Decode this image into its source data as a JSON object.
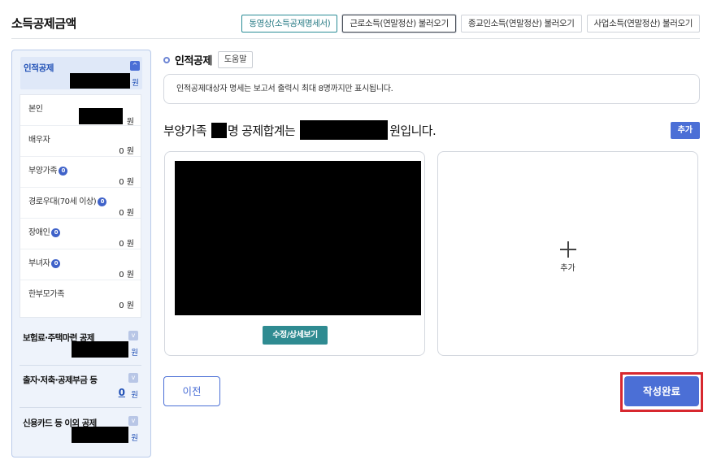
{
  "page_title": "소득공제금액",
  "top_tabs": [
    "동영상(소득공제명세서)",
    "근로소득(연말정산) 불러오기",
    "종교인소득(연말정산) 불러오기",
    "사업소득(연말정산) 불러오기"
  ],
  "sidebar": {
    "head": {
      "label": "인적공제",
      "toggle": "^",
      "unit": "원"
    },
    "sub_items": [
      {
        "label": "본인",
        "value": "원"
      },
      {
        "label": "배우자",
        "value": "0 원"
      },
      {
        "label": "부양가족",
        "badge": "0",
        "value": "0 원"
      },
      {
        "label": "경로우대(70세 이상)",
        "badge": "0",
        "value": "0 원"
      },
      {
        "label": "장애인",
        "badge": "0",
        "value": "0 원"
      },
      {
        "label": "부녀자",
        "badge": "0",
        "value": "0 원"
      },
      {
        "label": "한부모가족",
        "value": "0 원"
      }
    ],
    "groups": [
      {
        "label": "보험료·주택마련 공제",
        "unit": "원"
      },
      {
        "label": "출자·저축·공제부금 등",
        "zero": "0",
        "unit": "원"
      },
      {
        "label": "신용카드 등 이외 공제",
        "unit": "원"
      }
    ],
    "toggle_down": "v"
  },
  "main": {
    "section_title": "인적공제",
    "help_label": "도움말",
    "notice": "인적공제대상자 명세는 보고서 출력시 최대 8명까지만 표시됩니다.",
    "summary": {
      "prefix": "부양가족",
      "mid": "명 공제합계는",
      "suffix": "원입니다."
    },
    "add_button": "추가",
    "card_edit_button": "수정/상세보기",
    "card_add_label": "추가"
  },
  "footer": {
    "prev_button": "이전",
    "done_button": "작성완료"
  },
  "colors": {
    "accent": "#4b6fd6",
    "teal": "#2f8b91",
    "highlight": "#d7282f"
  }
}
